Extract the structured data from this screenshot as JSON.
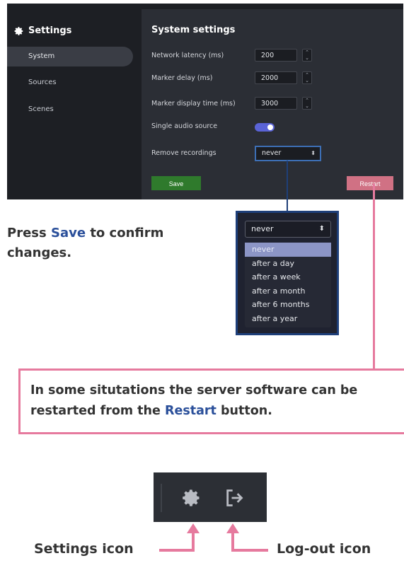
{
  "sidebar": {
    "title": "Settings",
    "items": [
      {
        "label": "System"
      },
      {
        "label": "Sources"
      },
      {
        "label": "Scenes"
      }
    ]
  },
  "panel": {
    "title": "System settings",
    "network_latency": {
      "label": "Network latency (ms)",
      "value": "200"
    },
    "marker_delay": {
      "label": "Marker delay (ms)",
      "value": "2000"
    },
    "marker_display_time": {
      "label": "Marker display time (ms)",
      "value": "3000"
    },
    "single_audio_source": {
      "label": "Single audio source",
      "enabled": true
    },
    "remove_recordings": {
      "label": "Remove recordings",
      "value": "never"
    },
    "save_label": "Save",
    "restart_label": "Restart"
  },
  "callouts": {
    "press_a": "Press ",
    "press_save": "Save",
    "press_b": " to confirm changes.",
    "restart_a": "In some situtations the server software can be restarted from the ",
    "restart_word": "Restart",
    "restart_b": " button."
  },
  "dropdown": {
    "current": "never",
    "options": [
      "never",
      "after a day",
      "after a week",
      "after a month",
      "after 6 months",
      "after a year"
    ]
  },
  "icons": {
    "settings_label": "Settings icon",
    "logout_label": "Log-out icon"
  },
  "colors": {
    "accent_blue": "#2a4f9a",
    "save_green": "#2f7a2c",
    "restart_pink": "#d07184",
    "callout_pink": "#e67a9e"
  }
}
